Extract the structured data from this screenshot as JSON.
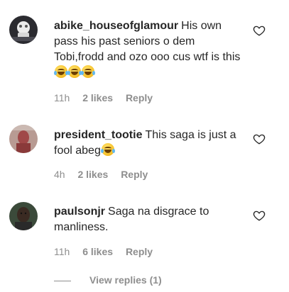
{
  "comments": [
    {
      "username": "abike_houseofglamour",
      "text": "His own pass his past seniors o dem Tobi,frodd and ozo ooo cus wtf is this",
      "emoji_count": 3,
      "time": "11h",
      "likes": "2 likes",
      "reply": "Reply"
    },
    {
      "username": "president_tootie",
      "text": "This saga is just a fool abeg",
      "emoji_count": 1,
      "time": "4h",
      "likes": "2 likes",
      "reply": "Reply"
    },
    {
      "username": "paulsonjr",
      "text": "Saga na disgrace to manliness.",
      "emoji_count": 0,
      "time": "11h",
      "likes": "6 likes",
      "reply": "Reply"
    }
  ],
  "view_replies": "View replies (1)",
  "icons": {
    "like": "heart-outline-icon",
    "emoji": "tears-of-joy-emoji"
  },
  "colors": {
    "text": "#262626",
    "muted": "#8e8e8e",
    "background": "#ffffff"
  }
}
